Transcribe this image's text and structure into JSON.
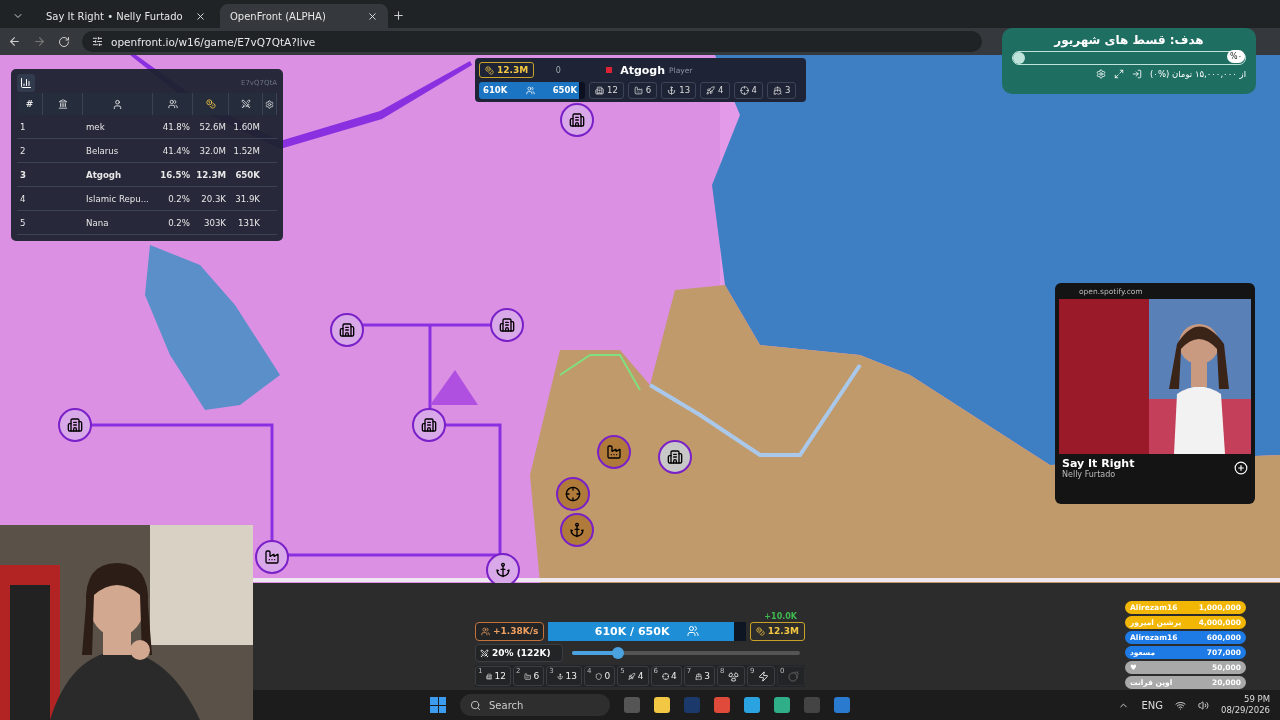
{
  "browser": {
    "tabs": [
      {
        "title": "Say It Right • Nelly Furtado",
        "selected": false
      },
      {
        "title": "OpenFront (ALPHA)",
        "selected": true
      }
    ],
    "url": "openfront.io/w16/game/E7vQ7QtA?live"
  },
  "leaderboard": {
    "game_id": "E7vQ7QtA",
    "rank_heading": "#",
    "rows": [
      {
        "rank": "1",
        "name": "mek",
        "share": "41.8%",
        "gold": "52.6M",
        "troops": "1.60M",
        "selected": false
      },
      {
        "rank": "2",
        "name": "Belarus",
        "share": "41.4%",
        "gold": "32.0M",
        "troops": "1.52M",
        "selected": false
      },
      {
        "rank": "3",
        "name": "Atgogh",
        "share": "16.5%",
        "gold": "12.3M",
        "troops": "650K",
        "selected": true
      },
      {
        "rank": "4",
        "name": "Islamic Repu...",
        "share": "0.2%",
        "gold": "20.3K",
        "troops": "31.9K",
        "selected": false
      },
      {
        "rank": "5",
        "name": "Nana",
        "share": "0.2%",
        "gold": "303K",
        "troops": "131K",
        "selected": false
      }
    ]
  },
  "player_bar": {
    "gold": "12.3M",
    "stat": "0",
    "name": "Atgogh",
    "type": "Player",
    "troops": "610K",
    "max_troops": "650K",
    "level": 0.94,
    "structures": [
      {
        "kind": "city",
        "count": "12"
      },
      {
        "kind": "factory",
        "count": "6"
      },
      {
        "kind": "port",
        "count": "13"
      },
      {
        "kind": "missile",
        "count": "4"
      },
      {
        "kind": "sam",
        "count": "4"
      },
      {
        "kind": "warship",
        "count": "3"
      }
    ]
  },
  "goal_widget": {
    "title": "هدف: قسط های شهریور",
    "percent": "%۰",
    "level": 0,
    "summary": "از ۱۵,۰۰۰,۰۰۰ تومان (%۰)"
  },
  "spotify": {
    "domain": "open.spotify.com",
    "track": "Say It Right",
    "artist": "Nelly Furtado"
  },
  "control_panel": {
    "rate": "+1.38K/s",
    "troops": "610K / 650K",
    "level": 0.94,
    "gold": "12.3M",
    "gain": "+10.0K",
    "attack": {
      "ratio": "20% (122K)",
      "level": 0.2
    },
    "hotbar": [
      {
        "key": "1",
        "kind": "city",
        "count": "12",
        "disabled": false
      },
      {
        "key": "2",
        "kind": "factory",
        "count": "6",
        "disabled": false
      },
      {
        "key": "3",
        "kind": "port",
        "count": "13",
        "disabled": false
      },
      {
        "key": "4",
        "kind": "defense",
        "count": "0",
        "disabled": false
      },
      {
        "key": "5",
        "kind": "missile",
        "count": "4",
        "disabled": false
      },
      {
        "key": "6",
        "kind": "sam",
        "count": "4",
        "disabled": false
      },
      {
        "key": "7",
        "kind": "warship",
        "count": "3",
        "disabled": false
      },
      {
        "key": "8",
        "kind": "nuke",
        "disabled": false
      },
      {
        "key": "9",
        "kind": "mirv",
        "disabled": false
      },
      {
        "key": "0",
        "kind": "bomb",
        "disabled": true
      }
    ]
  },
  "donations": [
    {
      "name": "Alirezam16",
      "amount": "1,000,000",
      "color": "#f2b705"
    },
    {
      "name": "پرشین امپرور",
      "amount": "4,000,000",
      "color": "#f2b705"
    },
    {
      "name": "Alirezam16",
      "amount": "600,000",
      "color": "#1e7be6"
    },
    {
      "name": "مسعود",
      "amount": "707,000",
      "color": "#1e7be6"
    },
    {
      "name": "♥",
      "amount": "50,000",
      "color": "#a9a9a9"
    },
    {
      "name": "اوپن فرانت",
      "amount": "20,000",
      "color": "#a9a9a9"
    }
  ],
  "taskbar": {
    "search_placeholder": "Search",
    "language": "ENG",
    "time": "59 PM",
    "date": "08/29/2026"
  }
}
